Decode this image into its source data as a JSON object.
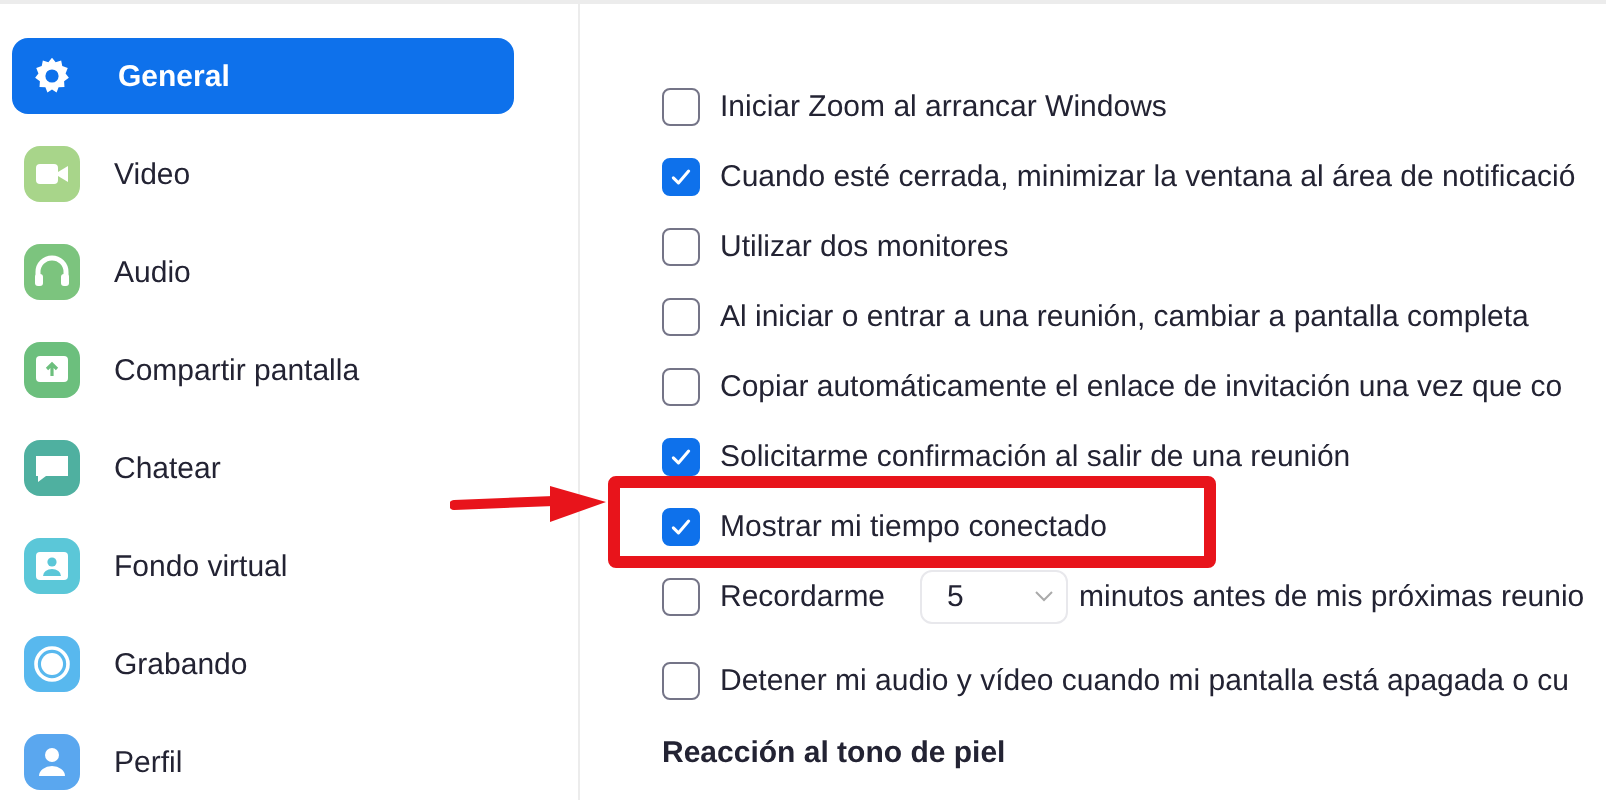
{
  "sidebar": {
    "items": [
      {
        "label": "General",
        "selected": true
      },
      {
        "label": "Video",
        "selected": false
      },
      {
        "label": "Audio",
        "selected": false
      },
      {
        "label": "Compartir pantalla",
        "selected": false
      },
      {
        "label": "Chatear",
        "selected": false
      },
      {
        "label": "Fondo virtual",
        "selected": false
      },
      {
        "label": "Grabando",
        "selected": false
      },
      {
        "label": "Perfil",
        "selected": false
      }
    ]
  },
  "options": [
    {
      "kind": "checkbox",
      "label": "Iniciar Zoom al arrancar Windows",
      "checked": false,
      "highlighted": false
    },
    {
      "kind": "checkbox",
      "label": "Cuando esté cerrada, minimizar la ventana al área de notificació",
      "checked": true,
      "highlighted": false
    },
    {
      "kind": "checkbox",
      "label": "Utilizar dos monitores",
      "checked": false,
      "highlighted": false
    },
    {
      "kind": "checkbox",
      "label": "Al iniciar o entrar a una reunión, cambiar a pantalla completa",
      "checked": false,
      "highlighted": false
    },
    {
      "kind": "checkbox",
      "label": "Copiar automáticamente el enlace de invitación una vez que co",
      "checked": false,
      "highlighted": false
    },
    {
      "kind": "checkbox",
      "label": "Solicitarme confirmación al salir de una reunión",
      "checked": true,
      "highlighted": false
    },
    {
      "kind": "checkbox",
      "label": "Mostrar mi tiempo conectado",
      "checked": true,
      "highlighted": true
    },
    {
      "kind": "reminder",
      "label": "Recordarme",
      "value": "5",
      "suffix": "minutos antes de mis próximas reunio",
      "checked": false,
      "highlighted": false
    },
    {
      "kind": "checkbox",
      "label": "Detener mi audio y vídeo cuando mi pantalla está apagada o cu",
      "checked": false,
      "highlighted": false
    }
  ],
  "section_heading": "Reacción al tono de piel"
}
